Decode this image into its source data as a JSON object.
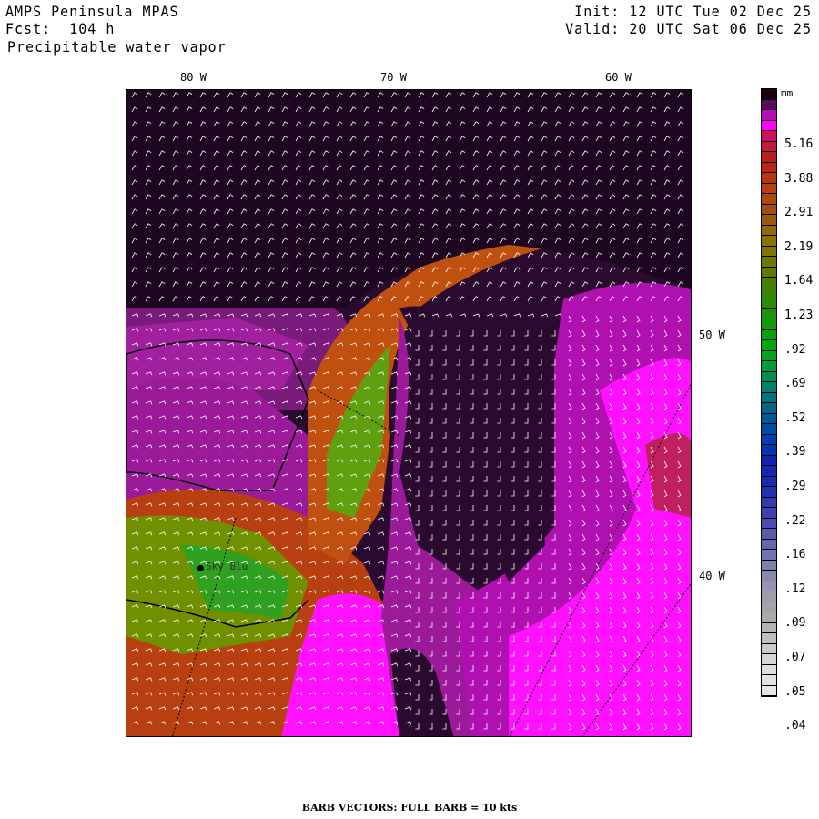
{
  "header": {
    "model": "AMPS Peninsula MPAS",
    "forecast": "Fcst:  104 h",
    "field": "Precipitable water vapor",
    "init": "Init: 12 UTC Tue 02 Dec 25",
    "valid": "Valid: 20 UTC Sat 06 Dec 25"
  },
  "axes": {
    "top": [
      "80 W",
      "70 W",
      "60 W"
    ],
    "right": [
      "50 W",
      "40 W"
    ]
  },
  "station": {
    "name": "Sky Blu"
  },
  "colorbar": {
    "units": "mm",
    "labels": [
      "5.16",
      "3.88",
      "2.91",
      "2.19",
      "1.64",
      "1.23",
      ".92",
      ".69",
      ".52",
      ".39",
      ".29",
      ".22",
      ".16",
      ".12",
      ".09",
      ".07",
      ".05",
      ".04"
    ],
    "top_colors": [
      "#160414",
      "#5c0a5c",
      "#b80cb8",
      "#ff00ff"
    ],
    "gradient_stops": [
      "#d01060",
      "#b82010",
      "#b84010",
      "#a05010",
      "#907000",
      "#707800",
      "#408000",
      "#209010",
      "#00a800",
      "#00a030",
      "#008070",
      "#006090",
      "#0040b0",
      "#1020b0",
      "#2030b0",
      "#4040b0",
      "#6060b0",
      "#8080b0",
      "#9898b0",
      "#a8a8a8",
      "#c0c0c0",
      "#dcdcdc",
      "#e6e6e6"
    ]
  },
  "footer": "BARB VECTORS:  FULL BARB = 10 kts"
}
